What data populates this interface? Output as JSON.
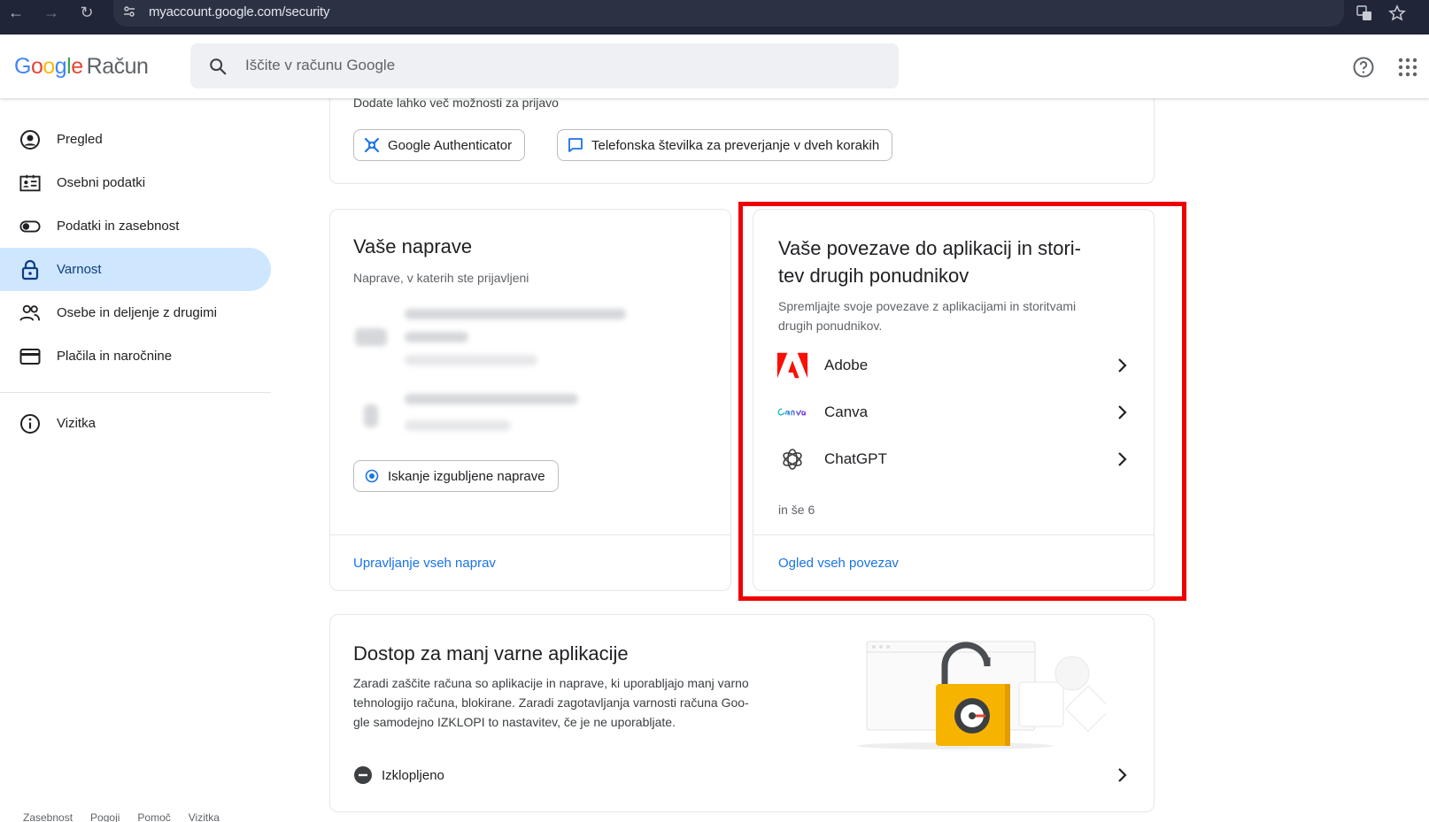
{
  "browser": {
    "url": "myaccount.google.com/security"
  },
  "header": {
    "logo_letters": [
      "G",
      "o",
      "o",
      "g",
      "l",
      "e"
    ],
    "product_name": "Račun",
    "search_placeholder": "Iščite v računu Google"
  },
  "sidebar": {
    "items": [
      {
        "label": "Pregled",
        "icon": "account-circle-icon",
        "active": false
      },
      {
        "label": "Osebni podatki",
        "icon": "id-card-icon",
        "active": false
      },
      {
        "label": "Podatki in zasebnost",
        "icon": "toggle-icon",
        "active": false
      },
      {
        "label": "Varnost",
        "icon": "lock-icon",
        "active": true
      },
      {
        "label": "Osebe in deljenje z drugimi",
        "icon": "people-icon",
        "active": false
      },
      {
        "label": "Plačila in naročnine",
        "icon": "credit-card-icon",
        "active": false
      }
    ],
    "about": {
      "label": "Vizitka",
      "icon": "info-icon"
    },
    "footer_links": [
      "Zasebnost",
      "Pogoji",
      "Pomoč",
      "Vizitka"
    ]
  },
  "signin_options": {
    "hint": "Dodate lahko več možnosti za prijavo",
    "chips": [
      "Google Authenticator",
      "Telefonska številka za preverjanje v dveh korakih"
    ]
  },
  "devices": {
    "title": "Vaše naprave",
    "subtitle": "Naprave, v katerih ste prijavljeni",
    "find_button": "Iskanje izgubljene naprave",
    "manage_link": "Upravljanje vseh naprav"
  },
  "connections": {
    "title_line1": "Vaše povezave do aplikacij in stori-",
    "title_line2": "tev drugih ponudnikov",
    "desc_line1": "Spremljajte svoje povezave z aplikacijami in storitvami",
    "desc_line2": "drugih ponudnikov.",
    "apps": [
      {
        "name": "Adobe",
        "icon": "adobe-logo-icon",
        "color": "#fa0f00"
      },
      {
        "name": "Canva",
        "icon": "canva-logo-icon",
        "color": "#00c4cc"
      },
      {
        "name": "ChatGPT",
        "icon": "chatgpt-logo-icon",
        "color": "#3c3c3c"
      }
    ],
    "more": "in še 6",
    "view_all_link": "Ogled vseh povezav"
  },
  "less_secure": {
    "title": "Dostop za manj varne aplikacije",
    "desc_line1": "Zaradi zaščite računa so aplikacije in naprave, ki uporabljajo manj varno",
    "desc_line2": "tehnologijo računa, blokirane. Zaradi zagotavljanja varnosti računa Goo-",
    "desc_line3": "gle samodejno IZKLOPI to nastavitev, če je ne uporabljate.",
    "status": "Izklopljeno"
  },
  "colors": {
    "accent": "#1a73e8",
    "active_nav": "#cfe6ff",
    "highlight": "#ee0000",
    "chrome": "#202638"
  }
}
